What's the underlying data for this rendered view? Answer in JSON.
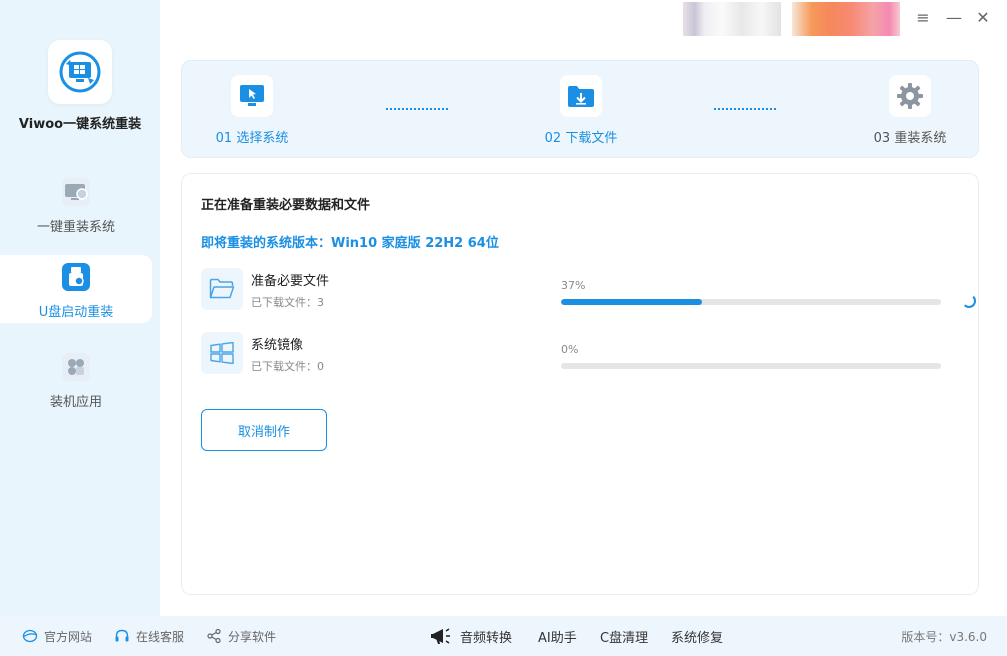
{
  "app": {
    "name": "Viwoo一键系统重装",
    "accent": "#1a8fe3"
  },
  "sidebar": {
    "items": [
      {
        "label": "一键重装系统",
        "icon": "monitor-refresh-icon",
        "active": false
      },
      {
        "label": "U盘启动重装",
        "icon": "usb-drive-icon",
        "active": true
      },
      {
        "label": "装机应用",
        "icon": "apps-grid-icon",
        "active": false
      }
    ]
  },
  "steps": [
    {
      "label": "01 选择系统",
      "icon": "monitor-cursor-icon"
    },
    {
      "label": "02 下载文件",
      "icon": "folder-download-icon"
    },
    {
      "label": "03 重装系统",
      "icon": "gear-icon"
    }
  ],
  "main": {
    "title": "正在准备重装必要数据和文件",
    "version_text": "即将重装的系统版本：Win10 家庭版 22H2 64位",
    "tasks": [
      {
        "name": "准备必要文件",
        "sub": "已下载文件：3",
        "percent_text": "37%",
        "progress": 0.37,
        "icon": "folder-icon"
      },
      {
        "name": "系统镜像",
        "sub": "已下载文件：0",
        "percent_text": "0%",
        "progress": 0,
        "icon": "windows-logo-icon"
      }
    ],
    "cancel_label": "取消制作"
  },
  "footer": {
    "left": [
      {
        "label": "官方网站",
        "icon": "globe-icon"
      },
      {
        "label": "在线客服",
        "icon": "headset-icon"
      },
      {
        "label": "分享软件",
        "icon": "share-icon"
      }
    ],
    "center": [
      {
        "label": "音频转换",
        "icon": "megaphone-icon"
      },
      {
        "label": "AI助手"
      },
      {
        "label": "C盘清理"
      },
      {
        "label": "系统修复"
      }
    ],
    "version": "版本号：v3.6.0"
  },
  "window": {
    "menu_icon": "≡",
    "minimize_icon": "—",
    "close_icon": "✕"
  }
}
